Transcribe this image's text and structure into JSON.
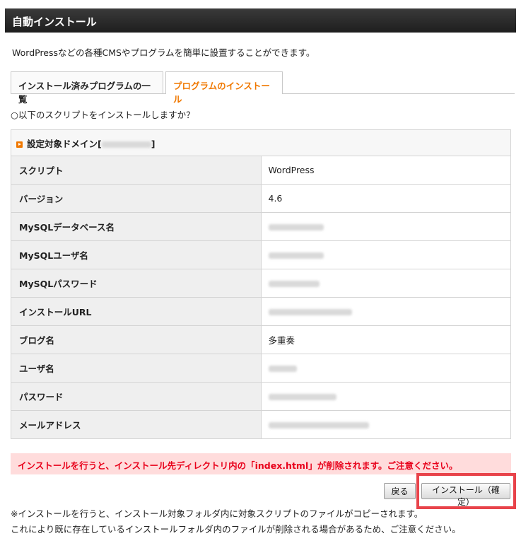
{
  "header": {
    "title": "自動インストール"
  },
  "intro": "WordPressなどの各種CMSやプログラムを簡単に設置することができます。",
  "tabs": [
    {
      "label": "インストール済みプログラムの一覧",
      "active": false
    },
    {
      "label": "プログラムのインストール",
      "active": true
    }
  ],
  "question": "○以下のスクリプトをインストールしますか？",
  "domain_row": {
    "prefix": "設定対象ドメイン[",
    "suffix": "]"
  },
  "rows": [
    {
      "label": "スクリプト",
      "value": "WordPress"
    },
    {
      "label": "バージョン",
      "value": "4.6"
    },
    {
      "label": "MySQLデータベース名",
      "value": ""
    },
    {
      "label": "MySQLユーザ名",
      "value": ""
    },
    {
      "label": "MySQLパスワード",
      "value": ""
    },
    {
      "label": "インストールURL",
      "value": ""
    },
    {
      "label": "ブログ名",
      "value": "多重奏"
    },
    {
      "label": "ユーザ名",
      "value": ""
    },
    {
      "label": "パスワード",
      "value": ""
    },
    {
      "label": "メールアドレス",
      "value": ""
    }
  ],
  "warning": "インストールを行うと、インストール先ディレクトリ内の「index.html」が削除されます。ご注意ください。",
  "buttons": {
    "back": "戻る",
    "install": "インストール（確定）"
  },
  "notes": [
    "※インストールを行うと、インストール対象フォルダ内に対象スクリプトのファイルがコピーされます。",
    "これにより既に存在しているインストールフォルダ内のファイルが削除される場合があるため、ご注意ください。"
  ],
  "colors": {
    "accent": "#f07800",
    "warning_text": "#e8001a",
    "warning_bg": "#ffdcdc",
    "highlight": "#e8434a"
  }
}
